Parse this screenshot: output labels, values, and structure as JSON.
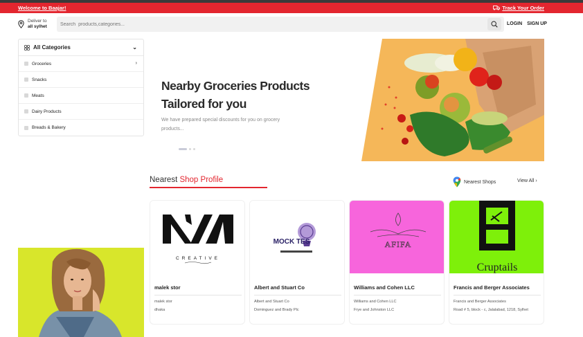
{
  "topbar": {
    "welcome": "Welcome to Baajar!",
    "track_order": "Track Your Order"
  },
  "header": {
    "deliver_to_label": "Deliver to",
    "deliver_to_location": "all sylhet",
    "search_placeholder": "Search  products,categories...",
    "login": "LOGIN",
    "signup": "SIGN UP"
  },
  "sidebar": {
    "title": "All Categories",
    "items": [
      {
        "label": "Groceries"
      },
      {
        "label": "Snacks"
      },
      {
        "label": "Meats"
      },
      {
        "label": "Dairy Products"
      },
      {
        "label": "Breads & Bakery"
      }
    ]
  },
  "hero": {
    "heading": "Nearby Groceries Products Tailored for you",
    "description": "We have prepared special discounts for you on grocery products..."
  },
  "shops_section": {
    "title_plain": "Nearest ",
    "title_accent": "Shop Profile",
    "nearest_shops": "Nearest Shops",
    "view_all": "View All",
    "cards": [
      {
        "name": "malek stor",
        "line1": "malek stor",
        "line2": "dhaka",
        "logo_bg": "#ffffff"
      },
      {
        "name": "Albert and Stuart Co",
        "line1": "Albert and Stuart Co",
        "line2": "Dominguez and Brady Plc",
        "logo_bg": "#ffffff"
      },
      {
        "name": "Williams and Cohen LLC",
        "line1": "Williams and Cohen LLC",
        "line2": "Frye and Johnston LLC",
        "logo_bg": "#f765dc"
      },
      {
        "name": "Francis and Berger Associates",
        "line1": "Francis and Berger Associates",
        "line2": "Road # 5, block - c, Jalalabad, 1218, Sylhet",
        "logo_bg": "#7ef00a"
      }
    ],
    "logo_texts": {
      "creative": "CREATIVE",
      "mock": "MOCK TES",
      "afifa": "AFIFA",
      "cruptails": "Cruptails"
    }
  },
  "colors": {
    "accent": "#e3262f",
    "promo_bg": "#d8e62b"
  }
}
